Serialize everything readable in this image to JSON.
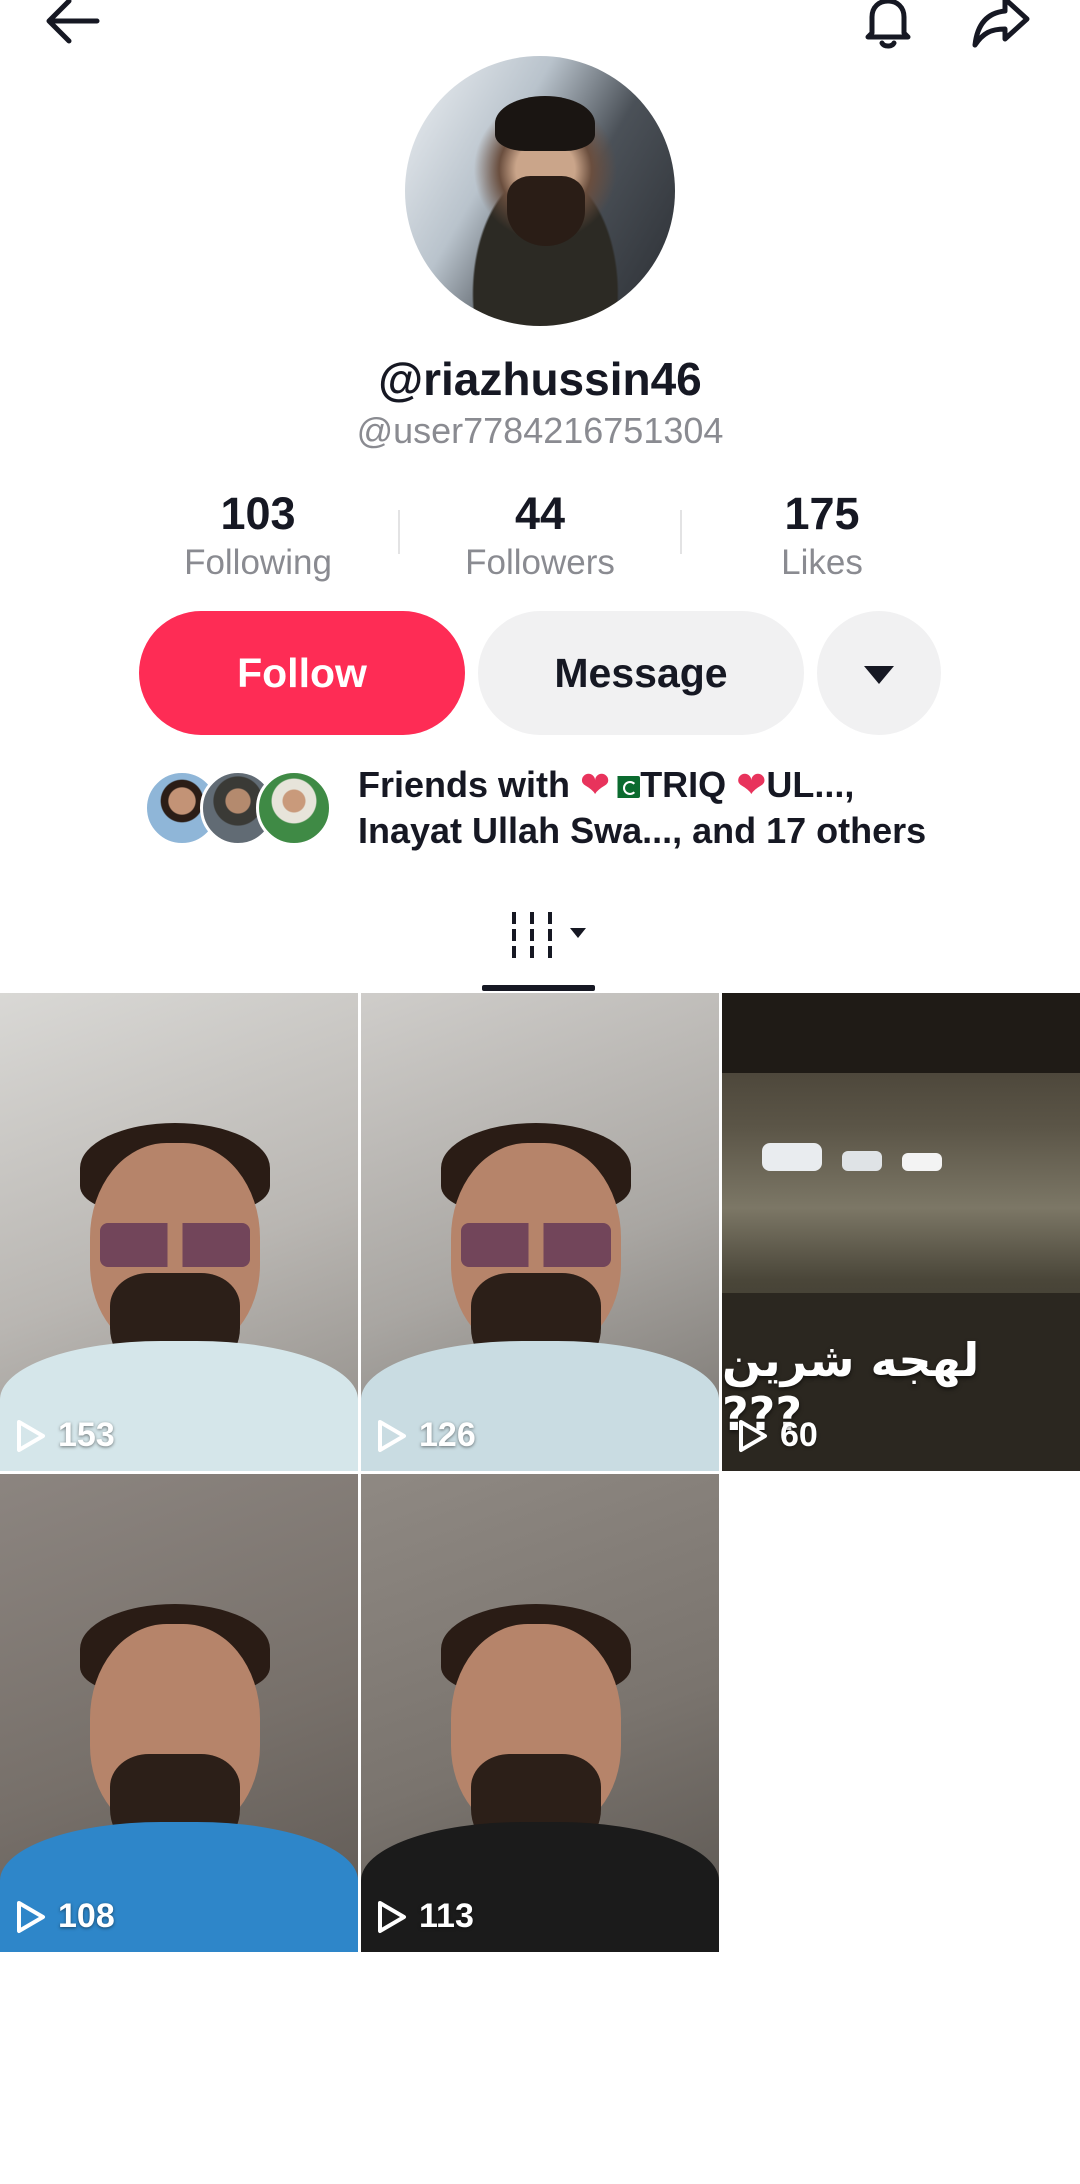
{
  "profile": {
    "display_name": "@riazhussin46",
    "username": "@user7784216751304"
  },
  "stats": [
    {
      "value": "103",
      "label": "Following"
    },
    {
      "value": "44",
      "label": "Followers"
    },
    {
      "value": "175",
      "label": "Likes"
    }
  ],
  "actions": {
    "follow_label": "Follow",
    "message_label": "Message"
  },
  "friends": {
    "line1_prefix": "Friends with ",
    "line1_name": "TRIQ ",
    "line1_suffix": "UL...,",
    "line2": "Inayat Ullah Swa..., and 17 others"
  },
  "videos": [
    {
      "views": "153"
    },
    {
      "views": "126"
    },
    {
      "views": "60",
      "caption": "لهجه شرين ???"
    },
    {
      "views": "108"
    },
    {
      "views": "113"
    }
  ],
  "colors": {
    "accent": "#fe2c55",
    "text": "#161823",
    "secondary_text": "#8a8b91",
    "button_bg": "#f1f1f2"
  },
  "icons": [
    "back-arrow-icon",
    "bell-icon",
    "share-icon",
    "dropdown-triangle-icon",
    "grid-tab-icon",
    "play-icon"
  ]
}
